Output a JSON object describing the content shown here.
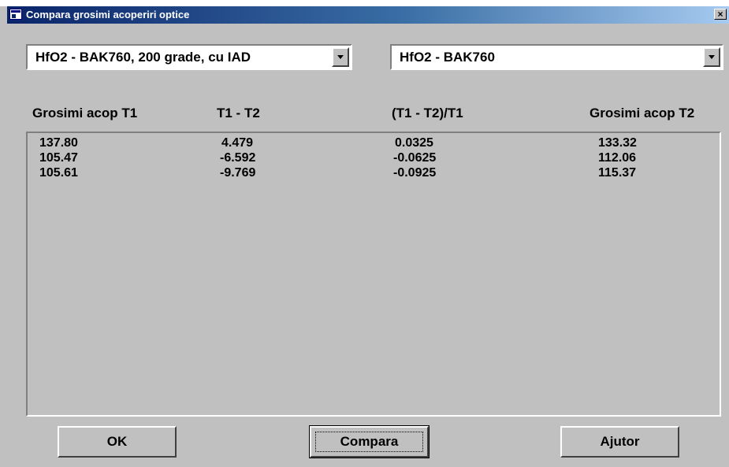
{
  "window": {
    "title": "Compara grosimi acoperiri optice",
    "close_label": "×"
  },
  "combos": {
    "left_value": "HfO2 - BAK760, 200 grade, cu IAD",
    "right_value": "HfO2 - BAK760"
  },
  "table": {
    "headers": [
      "Grosimi acop T1",
      "T1 - T2",
      "(T1 - T2)/T1",
      "Grosimi acop T2"
    ],
    "rows": [
      [
        "137.80",
        "4.479",
        "0.0325",
        "133.32"
      ],
      [
        "105.47",
        "-6.592",
        "-0.0625",
        "112.06"
      ],
      [
        "105.61",
        "-9.769",
        "-0.0925",
        "115.37"
      ]
    ]
  },
  "buttons": {
    "ok_label": "OK",
    "compare_label": "Compara",
    "help_label": "Ajutor"
  },
  "colors": {
    "dialog_face": "#c0c0c0",
    "titlebar_start": "#0a246a",
    "titlebar_end": "#a6caf0",
    "title_text": "#ffffff"
  }
}
